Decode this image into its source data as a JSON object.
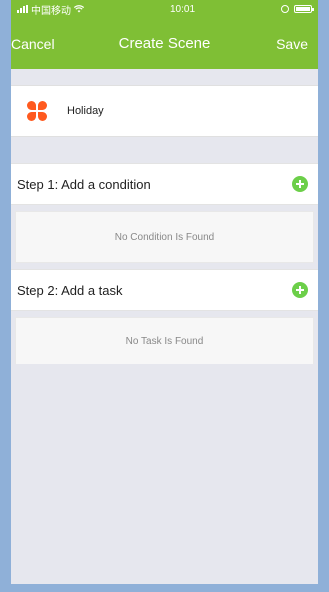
{
  "status_bar": {
    "carrier": "中国移动",
    "time": "10:01"
  },
  "nav": {
    "cancel_label": "Cancel",
    "title": "Create Scene",
    "save_label": "Save"
  },
  "scene": {
    "name": "Holiday",
    "icon": "clover-icon",
    "icon_color": "#ff5a1f"
  },
  "step1": {
    "label": "Step 1: Add a condition",
    "empty_text": "No Condition Is Found"
  },
  "step2": {
    "label": "Step 2: Add a task",
    "empty_text": "No Task Is Found"
  },
  "colors": {
    "accent": "#7fbf35",
    "add_button": "#6ccf49"
  }
}
